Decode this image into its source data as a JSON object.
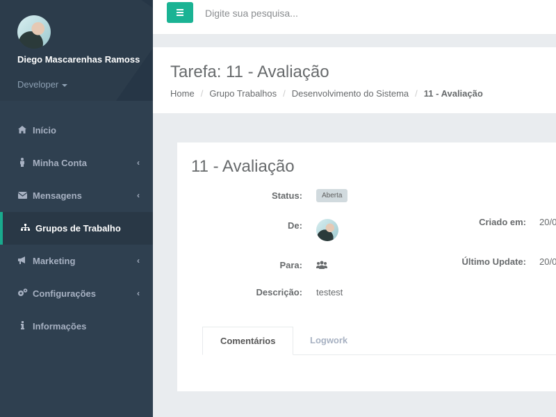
{
  "user": {
    "name": "Diego Mascarenhas Ramoss",
    "role": "Developer"
  },
  "sidebar": {
    "items": [
      {
        "label": "Início",
        "icon": "home-icon",
        "glyph": "⌂",
        "has_submenu": false,
        "active": false
      },
      {
        "label": "Minha Conta",
        "icon": "user-icon",
        "glyph": "👤",
        "has_submenu": true,
        "active": false
      },
      {
        "label": "Mensagens",
        "icon": "envelope-icon",
        "glyph": "✉",
        "has_submenu": true,
        "active": false
      },
      {
        "label": "Grupos de Trabalho",
        "icon": "sitemap-icon",
        "glyph": "⛬",
        "has_submenu": false,
        "active": true
      },
      {
        "label": "Marketing",
        "icon": "bullhorn-icon",
        "glyph": "📢",
        "has_submenu": true,
        "active": false
      },
      {
        "label": "Configurações",
        "icon": "cogs-icon",
        "glyph": "⚙",
        "has_submenu": true,
        "active": false
      },
      {
        "label": "Informações",
        "icon": "info-icon",
        "glyph": "ℹ",
        "has_submenu": false,
        "active": false
      }
    ]
  },
  "topbar": {
    "search_placeholder": "Digite sua pesquisa..."
  },
  "page": {
    "title": "Tarefa: 11 - Avaliação",
    "breadcrumb": [
      "Home",
      "Grupo Trabalhos",
      "Desenvolvimento do Sistema",
      "11 - Avaliação"
    ]
  },
  "task": {
    "title": "11 - Avaliação",
    "status_label": "Status:",
    "status_value": "Aberta",
    "from_label": "De:",
    "to_label": "Para:",
    "description_label": "Descrição:",
    "description_value": "testest",
    "created_label": "Criado em:",
    "created_value": "20/0",
    "updated_label": "Último Update:",
    "updated_value": "20/0"
  },
  "tabs": [
    {
      "label": "Comentários",
      "active": true
    },
    {
      "label": "Logwork",
      "active": false
    }
  ],
  "colors": {
    "accent": "#1ab394",
    "sidebar": "#2f4050",
    "active_border": "#19aa8d"
  }
}
